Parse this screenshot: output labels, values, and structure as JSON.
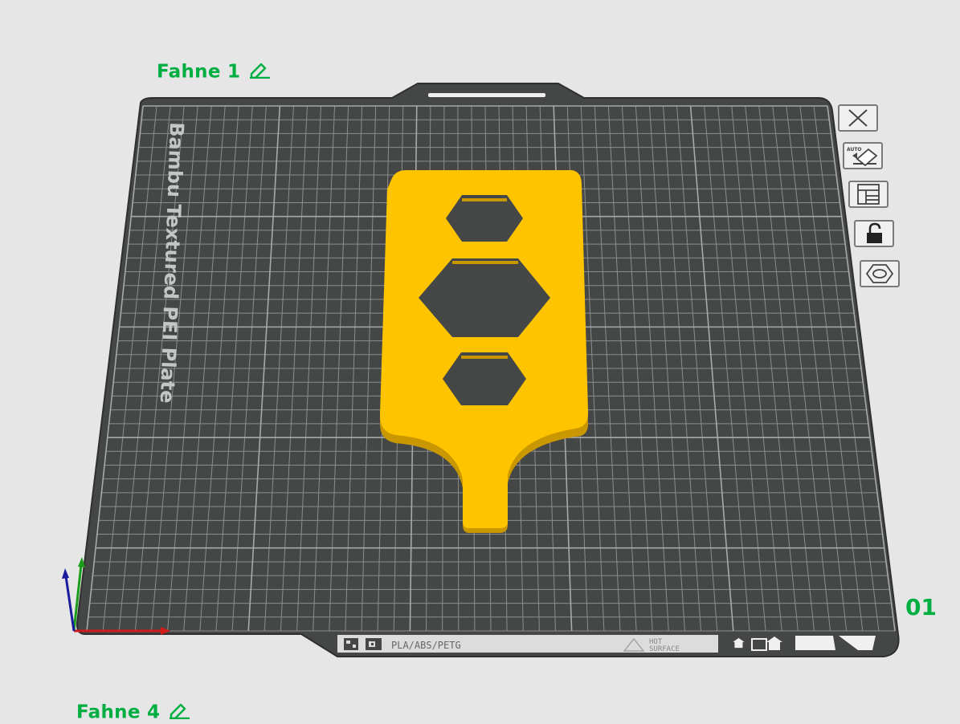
{
  "plates": [
    {
      "name": "Fahne 1",
      "edit_icon": "pencil-icon"
    },
    {
      "name": "Fahne 4",
      "edit_icon": "pencil-icon"
    }
  ],
  "plate_number": "01",
  "bed": {
    "label": "Bambu Textured PEI Plate",
    "footer_filaments": "PLA/ABS/PETG",
    "footer_warning_line1": "HOT",
    "footer_warning_line2": "SURFACE",
    "bed_color": "#454747",
    "grid_color": "#8c8e8e"
  },
  "model": {
    "color": "#ffc400",
    "edge_color": "#c99700"
  },
  "plate_toolbar": [
    {
      "id": "close",
      "icon": "close-icon"
    },
    {
      "id": "auto-orient",
      "icon": "auto-orient-icon",
      "text": "AUTO"
    },
    {
      "id": "arrange",
      "icon": "arrange-icon"
    },
    {
      "id": "lock",
      "icon": "lock-icon"
    },
    {
      "id": "settings",
      "icon": "plate-settings-icon"
    }
  ],
  "axes": {
    "x_color": "#d11a1a",
    "y_color": "#1a9c1a",
    "z_color": "#1a1a9c"
  }
}
